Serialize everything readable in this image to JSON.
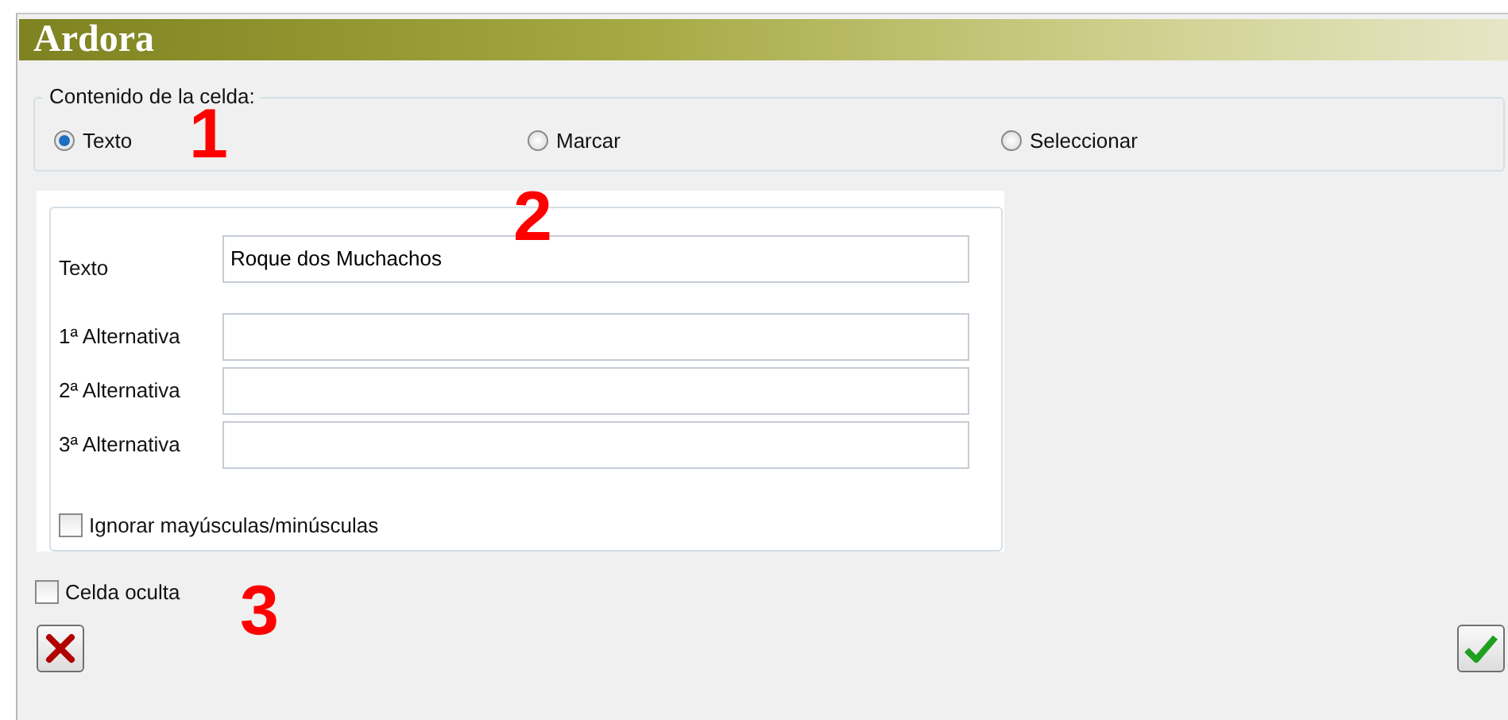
{
  "window": {
    "title": "Ardora"
  },
  "cell_content": {
    "legend": "Contenido de la celda:",
    "options": [
      {
        "label": "Texto",
        "selected": true
      },
      {
        "label": "Marcar",
        "selected": false
      },
      {
        "label": "Seleccionar",
        "selected": false
      }
    ]
  },
  "form": {
    "fields": [
      {
        "label": "Texto",
        "value": "Roque dos Muchachos"
      },
      {
        "label": "1ª Alternativa"
      },
      {
        "label": "2ª Alternativa"
      },
      {
        "label": "3ª Alternativa"
      }
    ],
    "ignore_case": {
      "label": "Ignorar mayúsculas/minúsculas",
      "checked": false
    }
  },
  "hidden_cell": {
    "label": "Celda oculta",
    "checked": false
  },
  "annotations": [
    "1",
    "2",
    "3"
  ],
  "buttons": [
    {
      "kind": "cancel"
    },
    {
      "kind": "ok"
    }
  ]
}
